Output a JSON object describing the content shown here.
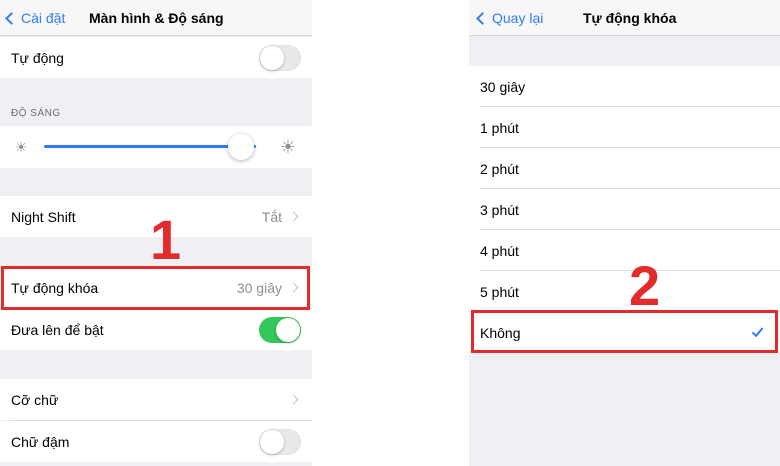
{
  "left": {
    "back_label": "Cài đặt",
    "title": "Màn hình & Độ sáng",
    "auto_row": {
      "label": "Tự động",
      "toggle_on": false
    },
    "brightness_header": "ĐỘ SÁNG",
    "brightness_level": 0.93,
    "night_shift": {
      "label": "Night Shift",
      "value": "Tắt"
    },
    "auto_lock": {
      "label": "Tự động khóa",
      "value": "30 giây"
    },
    "raise_to_wake": {
      "label": "Đưa lên để bật",
      "toggle_on": true
    },
    "text_size": {
      "label": "Cỡ chữ"
    },
    "bold_text": {
      "label": "Chữ đậm",
      "toggle_on": false
    }
  },
  "right": {
    "back_label": "Quay lại",
    "title": "Tự động khóa",
    "options": [
      "30 giây",
      "1 phút",
      "2 phút",
      "3 phút",
      "4 phút",
      "5 phút",
      "Không"
    ],
    "selected": "Không"
  },
  "annotations": {
    "step1": "1",
    "step2": "2",
    "color": "#e32b2b"
  },
  "colors": {
    "accent": "#2f7cf6",
    "toggle_on": "#34c759"
  }
}
